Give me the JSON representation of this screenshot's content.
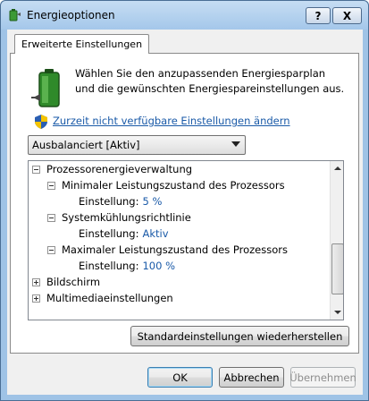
{
  "window": {
    "title": "Energieoptionen",
    "help_label": "?",
    "close_label": "X",
    "title_icon": "power-options-icon"
  },
  "tab": {
    "label": "Erweiterte Einstellungen"
  },
  "intro": {
    "text": "Wählen Sie den anzupassenden Energiesparplan und die gewünschten Energiespareinstellungen aus.",
    "icon": "battery-plug-icon"
  },
  "link": {
    "text": "Zurzeit nicht verfügbare Einstellungen ändern",
    "icon": "uac-shield-icon"
  },
  "plan_select": {
    "value": "Ausbalanciert [Aktiv]"
  },
  "tree": {
    "processor_group": "Prozessorenergieverwaltung",
    "min_state": {
      "label": "Minimaler Leistungszustand des Prozessors",
      "setting_label": "Einstellung:",
      "value": "5 %"
    },
    "cooling_policy": {
      "label": "Systemkühlungsrichtlinie",
      "setting_label": "Einstellung:",
      "value": "Aktiv"
    },
    "max_state": {
      "label": "Maximaler Leistungszustand des Prozessors",
      "setting_label": "Einstellung:",
      "value": "100 %"
    },
    "display_group": "Bildschirm",
    "multimedia_group": "Multimediaeinstellungen"
  },
  "buttons": {
    "restore": "Standardeinstellungen wiederherstellen",
    "ok": "OK",
    "cancel": "Abbrechen",
    "apply": "Übernehmen"
  },
  "colors": {
    "link": "#1a5aa8",
    "value": "#1a5aa8",
    "frame": "#9fc3e6"
  }
}
